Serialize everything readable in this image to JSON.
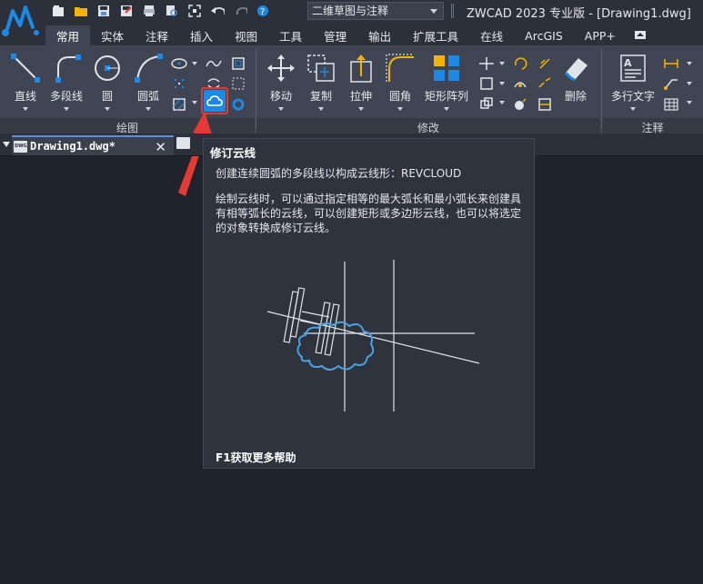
{
  "app": {
    "title": "ZWCAD 2023 专业版 - [Drawing1.dwg]",
    "workspace": "二维草图与注释",
    "accent_color": "#1e88e5",
    "highlight_color": "#e53935"
  },
  "quick_access": [
    "new-icon",
    "open-icon",
    "save-icon",
    "save-as-icon",
    "plot-icon",
    "print-preview-icon",
    "zoom-extents-icon",
    "undo-icon",
    "redo-icon",
    "help-icon"
  ],
  "tabs": [
    "常用",
    "实体",
    "注释",
    "插入",
    "视图",
    "工具",
    "管理",
    "输出",
    "扩展工具",
    "在线",
    "ArcGIS",
    "APP+"
  ],
  "ribbon": {
    "draw": {
      "title": "绘图",
      "line": "直线",
      "polyline": "多段线",
      "circle": "圆",
      "arc": "圆弧"
    },
    "modify": {
      "title": "修改",
      "move": "移动",
      "copy": "复制",
      "stretch": "拉伸",
      "fillet": "圆角",
      "array": "矩形阵列",
      "erase": "删除"
    },
    "annotation": {
      "title": "注释",
      "mtext": "多行文字"
    }
  },
  "document": {
    "tab_name": "Drawing1.dwg*",
    "close_label": "✕"
  },
  "tooltip": {
    "title": "修订云线",
    "description": "创建连续圆弧的多段线以构成云线形：REVCLOUD",
    "body": "绘制云线时，可以通过指定相等的最大弧长和最小弧长来创建具有相等弧长的云线，可以创建矩形或多边形云线，也可以将选定的对象转换成修订云线。",
    "help": "F1获取更多帮助"
  }
}
